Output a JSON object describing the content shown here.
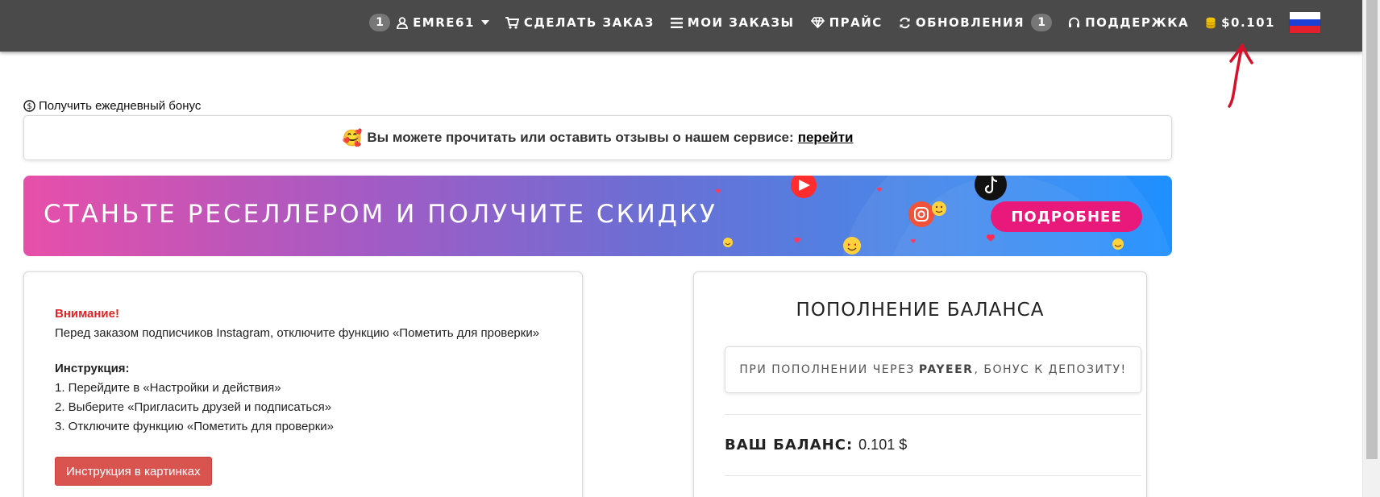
{
  "nav": {
    "notifications_count": "1",
    "username": "EMRE61",
    "order": "СДЕЛАТЬ ЗАКАЗ",
    "my_orders": "МОИ ЗАКАЗЫ",
    "price": "ПРАЙС",
    "updates": "ОБНОВЛЕНИЯ",
    "updates_count": "1",
    "support": "ПОДДЕРЖКА",
    "balance": "$0.101",
    "language_flag": "russia-flag"
  },
  "bonus_link": "Получить ежедневный бонус",
  "reviews": {
    "emoji": "🥰",
    "text": "Вы можете прочитать или оставить отзывы о нашем сервисе:",
    "link": "перейти"
  },
  "banner": {
    "title": "СТАНЬТЕ РЕСЕЛЛЕРОМ И ПОЛУЧИТЕ СКИДКУ",
    "button": "ПОДРОБНЕЕ"
  },
  "notice": {
    "warning_title": "Внимание!",
    "warning_text": "Перед заказом подписчиков Instagram, отключите функцию «Пометить для проверки»",
    "instruction_title": "Инструкция:",
    "steps": [
      "1. Перейдите в «Настройки и действия»",
      "2. Выберите «Пригласить друзей и подписаться»",
      "3. Отключите функцию «Пометить для проверки»"
    ],
    "pictures_button": "Инструкция в картинках"
  },
  "topup": {
    "title": "ПОПОЛНЕНИЕ БАЛАНСА",
    "payeer_prefix": "ПРИ ПОПОЛНЕНИИ ЧЕРЕЗ",
    "payeer_name": "PAYEER",
    "payeer_suffix": ", БОНУС К ДЕПОЗИТУ!",
    "balance_label": "ВАШ БАЛАНС:",
    "balance_value": "0.101 $"
  },
  "colors": {
    "nav_bg": "#4a4a4a",
    "accent_pink": "#e8197a",
    "danger": "#d9534f",
    "warning_text": "#e02424",
    "coin": "#f2c200"
  }
}
